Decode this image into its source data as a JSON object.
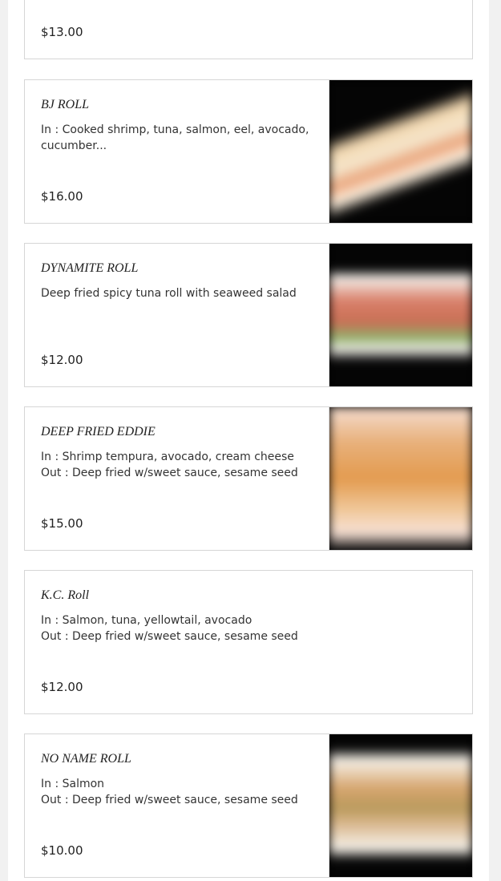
{
  "items": [
    {
      "price": "$13.00"
    },
    {
      "name": "BJ ROLL",
      "desc": "In : Cooked shrimp, tuna, salmon, eel, avocado, cucumber...",
      "price": "$16.00",
      "photo": "sushi-roll-photo"
    },
    {
      "name": "DYNAMITE ROLL",
      "desc": "Deep fried spicy tuna roll with seaweed salad",
      "price": "$12.00",
      "photo": "sushi-roll-photo"
    },
    {
      "name": "DEEP FRIED EDDIE",
      "desc_in": "In : Shrimp tempura, avocado, cream cheese",
      "desc_out": "Out : Deep fried w/sweet sauce, sesame seed",
      "price": "$15.00",
      "photo": "sushi-roll-photo"
    },
    {
      "name": "K.C. Roll",
      "desc_in": "In : Salmon, tuna, yellowtail, avocado",
      "desc_out": "Out : Deep fried w/sweet sauce, sesame seed",
      "price": "$12.00"
    },
    {
      "name": "NO NAME ROLL",
      "desc_in": "In : Salmon",
      "desc_out": "Out : Deep fried w/sweet sauce, sesame seed",
      "price": "$10.00",
      "photo": "sushi-roll-photo"
    }
  ]
}
